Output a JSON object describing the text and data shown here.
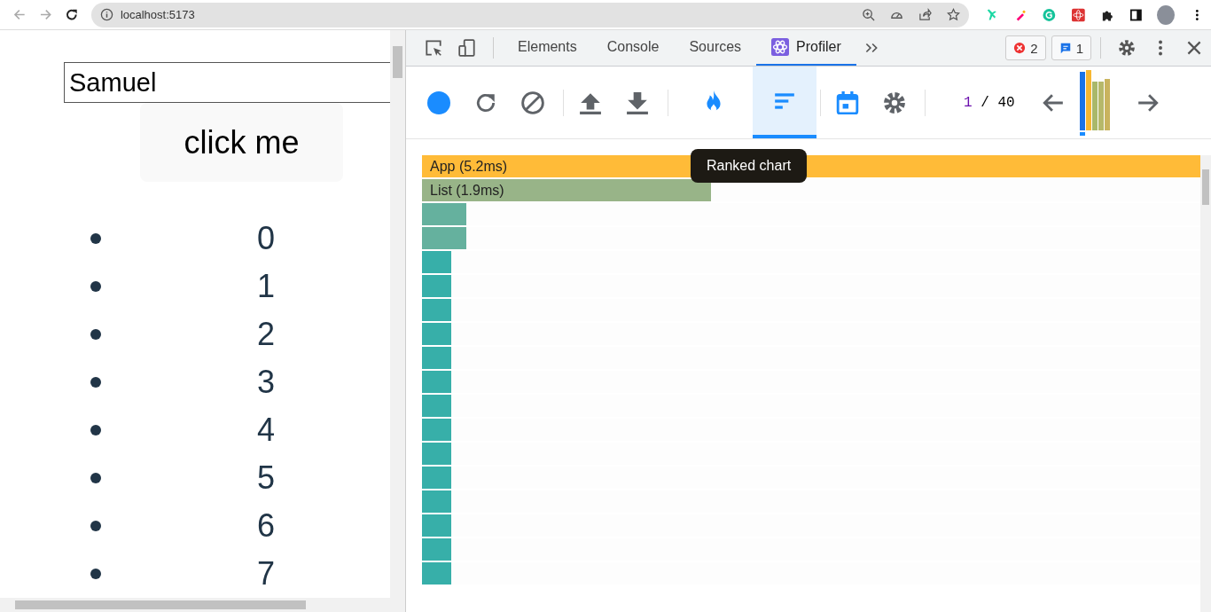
{
  "browser": {
    "url": "localhost:5173"
  },
  "page": {
    "input_value": "Samuel",
    "button": "click me",
    "list": [
      "0",
      "1",
      "2",
      "3",
      "4",
      "5",
      "6",
      "7"
    ]
  },
  "devtools": {
    "tabs": [
      {
        "label": "Elements",
        "selected": false
      },
      {
        "label": "Console",
        "selected": false
      },
      {
        "label": "Sources",
        "selected": false
      },
      {
        "label": "Profiler",
        "selected": true
      }
    ],
    "errors": "2",
    "messages": "1"
  },
  "profiler": {
    "views": [
      {
        "kind": "flame",
        "selected": false
      },
      {
        "kind": "ranked",
        "selected": true
      }
    ],
    "commit_index": "1",
    "commit_separator": "/",
    "commit_total": "40",
    "commits": [
      {
        "level": 0.97,
        "color": "#1a73e8",
        "selected": true
      },
      {
        "level": 1.0,
        "color": "#f7b731",
        "selected": false
      },
      {
        "level": 0.8,
        "color": "#a9b86a",
        "selected": false
      },
      {
        "level": 0.8,
        "color": "#b6b86a",
        "selected": false
      },
      {
        "level": 0.85,
        "color": "#c9b35e",
        "selected": false
      }
    ],
    "tooltip": "Ranked chart",
    "rows": [
      {
        "label": "App (5.2ms)",
        "level": 1.0,
        "color": "#ffbb38"
      },
      {
        "label": "List (1.9ms)",
        "level": 0.371,
        "color": "#98b488"
      },
      {
        "level": 0.057,
        "color": "#65b19e"
      },
      {
        "level": 0.057,
        "color": "#65b19e"
      },
      {
        "level": 0.038,
        "color": "#37afa9"
      },
      {
        "level": 0.038,
        "color": "#37afa9"
      },
      {
        "level": 0.038,
        "color": "#37afa9"
      },
      {
        "level": 0.038,
        "color": "#37afa9"
      },
      {
        "level": 0.038,
        "color": "#37afa9"
      },
      {
        "level": 0.038,
        "color": "#37afa9"
      },
      {
        "level": 0.038,
        "color": "#37afa9"
      },
      {
        "level": 0.038,
        "color": "#37afa9"
      },
      {
        "level": 0.038,
        "color": "#37afa9"
      },
      {
        "level": 0.038,
        "color": "#37afa9"
      },
      {
        "level": 0.038,
        "color": "#37afa9"
      },
      {
        "level": 0.038,
        "color": "#37afa9"
      },
      {
        "level": 0.038,
        "color": "#37afa9"
      },
      {
        "level": 0.038,
        "color": "#37afa9"
      }
    ]
  }
}
